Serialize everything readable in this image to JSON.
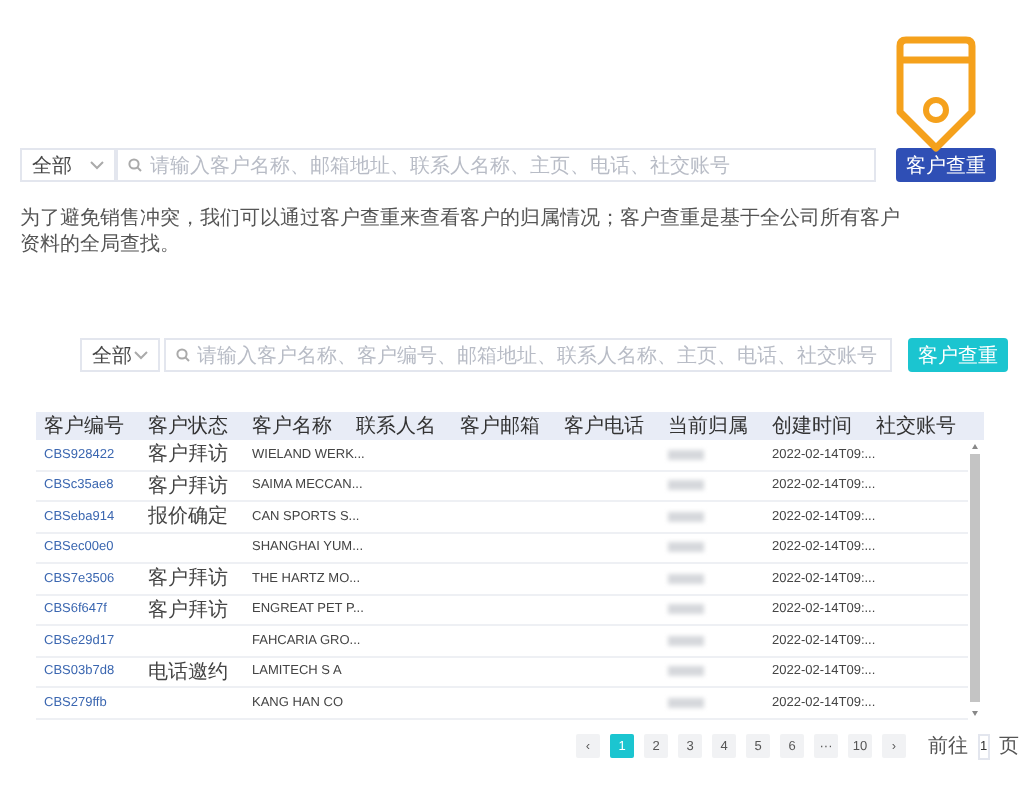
{
  "top_search": {
    "scope": "全部",
    "placeholder": "请输入客户名称、邮箱地址、联系人名称、主页、电话、社交账号",
    "button": "客户查重"
  },
  "description": "为了避免销售冲突，我们可以通过客户查重来查看客户的归属情况；客户查重是基于全公司所有客户资料的全局查找。",
  "search": {
    "scope": "全部",
    "placeholder": "请输入客户名称、客户编号、邮箱地址、联系人名称、主页、电话、社交账号",
    "button": "客户查重"
  },
  "table": {
    "columns": [
      "客户编号",
      "客户状态",
      "客户名称",
      "联系人名",
      "客户邮箱",
      "客户电话",
      "当前归属",
      "创建时间",
      "社交账号"
    ],
    "rows": [
      {
        "id": "CBS928422",
        "status": "客户拜访",
        "name": "WIELAND WERK...",
        "created": "2022-02-14T09:..."
      },
      {
        "id": "CBSc35ae8",
        "status": "客户拜访",
        "name": "SAIMA MECCAN...",
        "created": "2022-02-14T09:..."
      },
      {
        "id": "CBSeba914",
        "status": "报价确定",
        "name": "CAN SPORTS S...",
        "created": "2022-02-14T09:..."
      },
      {
        "id": "CBSec00e0",
        "status": "",
        "name": "SHANGHAI YUM...",
        "created": "2022-02-14T09:..."
      },
      {
        "id": "CBS7e3506",
        "status": "客户拜访",
        "name": "THE HARTZ MO...",
        "created": "2022-02-14T09:..."
      },
      {
        "id": "CBS6f647f",
        "status": "客户拜访",
        "name": "ENGREAT PET P...",
        "created": "2022-02-14T09:..."
      },
      {
        "id": "CBSe29d17",
        "status": "",
        "name": "FAHCARIA GRO...",
        "created": "2022-02-14T09:..."
      },
      {
        "id": "CBS03b7d8",
        "status": "电话邀约",
        "name": "LAMITECH S A",
        "created": "2022-02-14T09:..."
      },
      {
        "id": "CBS279ffb",
        "status": "",
        "name": "KANG HAN CO",
        "created": "2022-02-14T09:..."
      }
    ]
  },
  "pagination": {
    "prev": "‹",
    "pages": [
      {
        "label": "1",
        "selected": true
      },
      {
        "label": "2",
        "selected": false
      },
      {
        "label": "3",
        "selected": false
      },
      {
        "label": "4",
        "selected": false
      },
      {
        "label": "5",
        "selected": false
      },
      {
        "label": "6",
        "selected": false
      },
      {
        "label": "···",
        "selected": false
      },
      {
        "label": "10",
        "selected": false
      }
    ],
    "next": "›",
    "goto_label": "前往",
    "goto_value": "1",
    "goto_unit": "页"
  }
}
